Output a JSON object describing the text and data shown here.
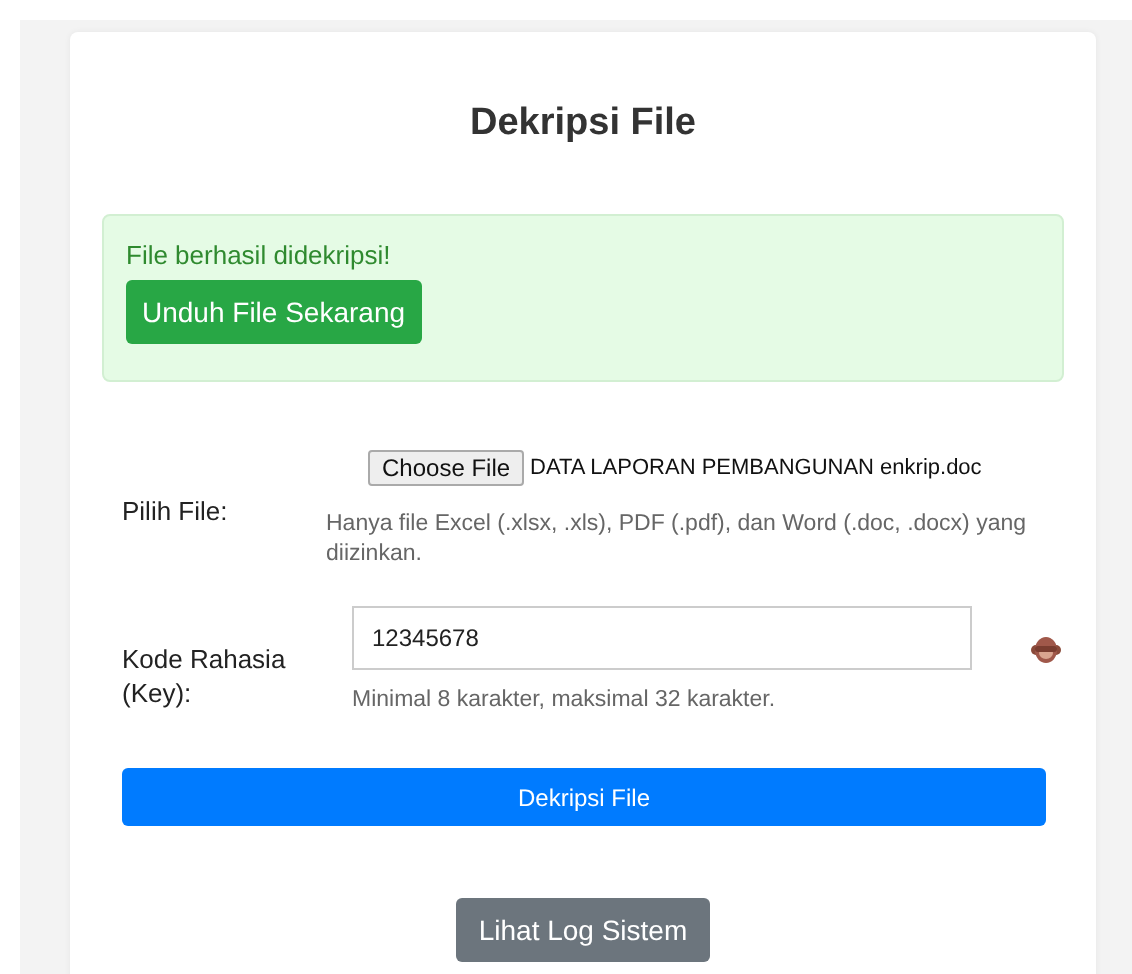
{
  "title": "Dekripsi File",
  "alert": {
    "message": "File berhasil didekripsi!",
    "button": "Unduh File Sekarang"
  },
  "file_field": {
    "label": "Pilih File:",
    "button": "Choose File",
    "file_name": "DATA LAPORAN PEMBANGUNAN enkrip.doc",
    "hint": "Hanya file Excel (.xlsx, .xls), PDF (.pdf), dan Word (.doc, .docx) yang diizinkan."
  },
  "key_field": {
    "label": "Kode Rahasia (Key):",
    "value": "12345678",
    "hint": "Minimal 8 karakter, maksimal 32 karakter."
  },
  "submit_button": "Dekripsi File",
  "log_button": "Lihat Log Sistem"
}
